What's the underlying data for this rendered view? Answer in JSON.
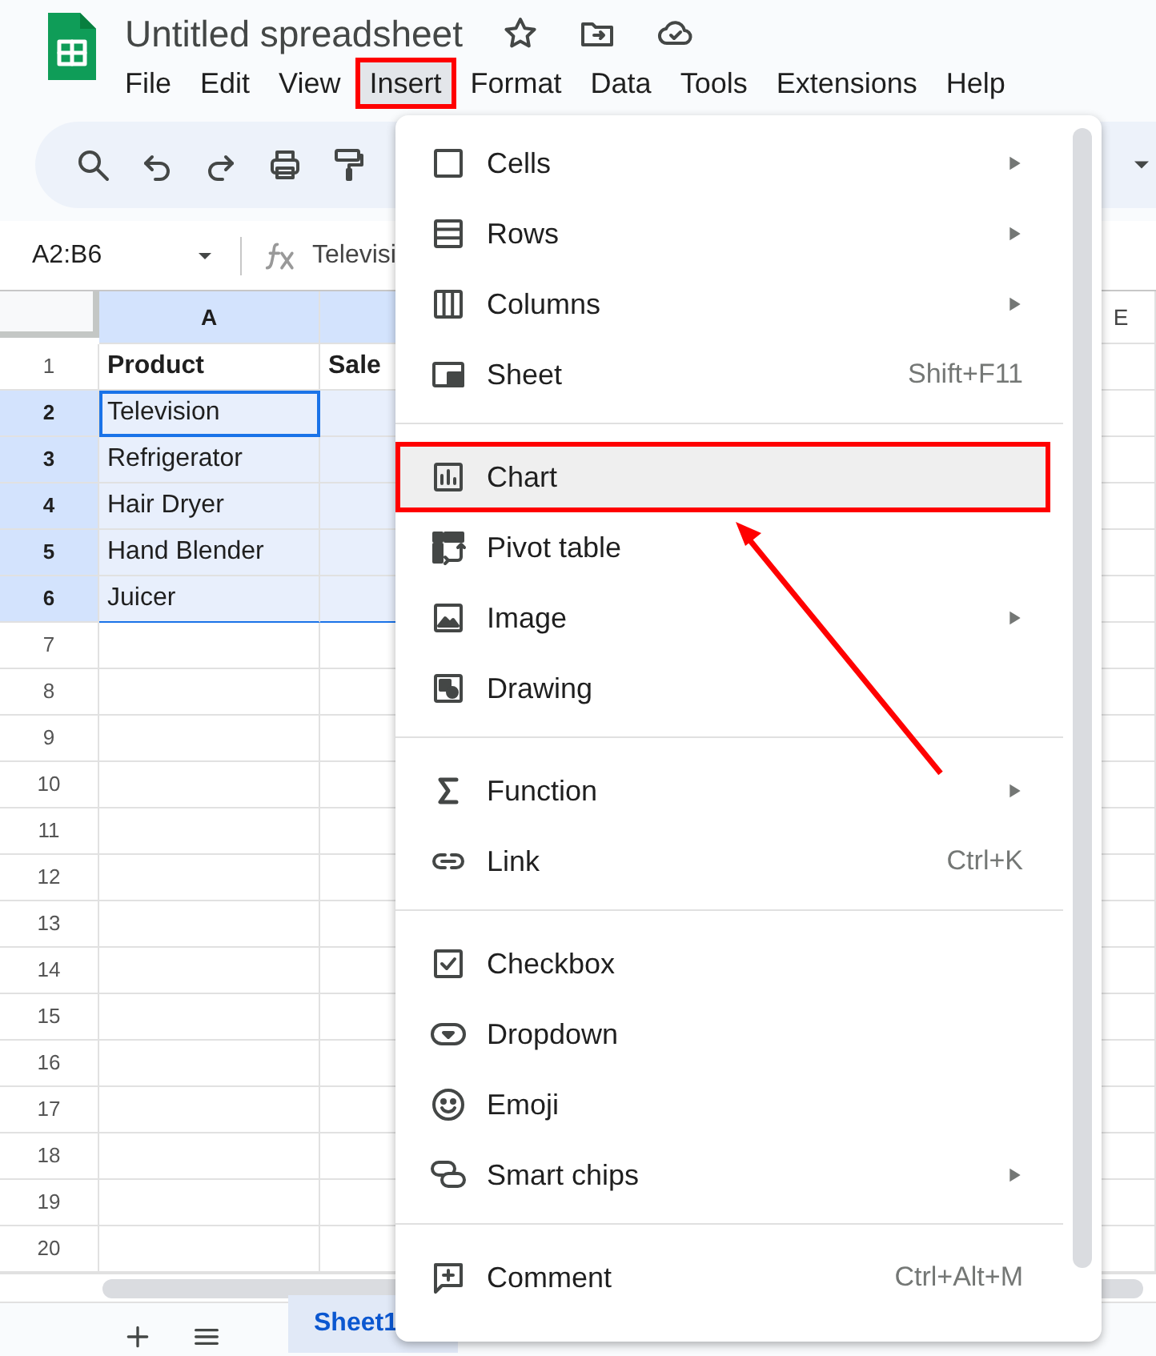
{
  "document": {
    "title": "Untitled spreadsheet"
  },
  "menubar": [
    {
      "label": "File",
      "selected": false,
      "annotated": false
    },
    {
      "label": "Edit",
      "selected": false,
      "annotated": false
    },
    {
      "label": "View",
      "selected": false,
      "annotated": false
    },
    {
      "label": "Insert",
      "selected": true,
      "annotated": true
    },
    {
      "label": "Format",
      "selected": false,
      "annotated": false
    },
    {
      "label": "Data",
      "selected": false,
      "annotated": false
    },
    {
      "label": "Tools",
      "selected": false,
      "annotated": false
    },
    {
      "label": "Extensions",
      "selected": false,
      "annotated": false
    },
    {
      "label": "Help",
      "selected": false,
      "annotated": false
    }
  ],
  "formula_bar": {
    "name_box": "A2:B6",
    "value": "Televisi"
  },
  "columns": [
    {
      "label": "A",
      "selected": true
    },
    {
      "selected": true
    },
    {
      "label": "E",
      "selected": false
    }
  ],
  "rows": [
    {
      "header": "1",
      "kind": "header",
      "selected": false,
      "cells": [
        {
          "text": "Product",
          "active": false
        },
        {
          "text": "Sale",
          "active": false
        }
      ]
    },
    {
      "header": "2",
      "kind": "data",
      "selected": true,
      "cells": [
        {
          "text": "Television",
          "active": true
        }
      ]
    },
    {
      "header": "3",
      "kind": "data",
      "selected": true,
      "cells": [
        {
          "text": "Refrigerator",
          "active": false
        }
      ]
    },
    {
      "header": "4",
      "kind": "data",
      "selected": true,
      "cells": [
        {
          "text": "Hair Dryer",
          "active": false
        }
      ]
    },
    {
      "header": "5",
      "kind": "data",
      "selected": true,
      "cells": [
        {
          "text": "Hand Blender",
          "active": false
        }
      ]
    },
    {
      "header": "6",
      "kind": "data",
      "selected": true,
      "cells": [
        {
          "text": "Juicer",
          "active": false
        }
      ]
    },
    {
      "header": "7",
      "kind": "data",
      "selected": false,
      "cells": []
    },
    {
      "header": "8",
      "kind": "data",
      "selected": false,
      "cells": []
    },
    {
      "header": "9",
      "kind": "data",
      "selected": false,
      "cells": []
    },
    {
      "header": "10",
      "kind": "data",
      "selected": false,
      "cells": []
    },
    {
      "header": "11",
      "kind": "data",
      "selected": false,
      "cells": []
    },
    {
      "header": "12",
      "kind": "data",
      "selected": false,
      "cells": []
    },
    {
      "header": "13",
      "kind": "data",
      "selected": false,
      "cells": []
    },
    {
      "header": "14",
      "kind": "data",
      "selected": false,
      "cells": []
    },
    {
      "header": "15",
      "kind": "data",
      "selected": false,
      "cells": []
    },
    {
      "header": "16",
      "kind": "data",
      "selected": false,
      "cells": []
    },
    {
      "header": "17",
      "kind": "data",
      "selected": false,
      "cells": []
    },
    {
      "header": "18",
      "kind": "data",
      "selected": false,
      "cells": []
    },
    {
      "header": "19",
      "kind": "data",
      "selected": false,
      "cells": []
    },
    {
      "header": "20",
      "kind": "data",
      "selected": false,
      "cells": []
    }
  ],
  "sheet_tabs": [
    {
      "label": "Sheet1",
      "selected": true
    }
  ],
  "insert_menu": {
    "groups": [
      [
        {
          "label": "Cells",
          "submenu": true,
          "highlighted": false,
          "annotated": false
        },
        {
          "label": "Rows",
          "submenu": true,
          "highlighted": false,
          "annotated": false
        },
        {
          "label": "Columns",
          "submenu": true,
          "highlighted": false,
          "annotated": false
        },
        {
          "label": "Sheet",
          "shortcut": "Shift+F11",
          "submenu": false,
          "highlighted": false,
          "annotated": false
        }
      ],
      [
        {
          "label": "Chart",
          "submenu": false,
          "highlighted": true,
          "annotated": true
        },
        {
          "label": "Pivot table",
          "submenu": false,
          "highlighted": false,
          "annotated": false
        },
        {
          "label": "Image",
          "submenu": true,
          "highlighted": false,
          "annotated": false
        },
        {
          "label": "Drawing",
          "submenu": false,
          "highlighted": false,
          "annotated": false
        }
      ],
      [
        {
          "label": "Function",
          "submenu": true,
          "highlighted": false,
          "annotated": false
        },
        {
          "label": "Link",
          "shortcut": "Ctrl+K",
          "submenu": false,
          "highlighted": false,
          "annotated": false
        }
      ],
      [
        {
          "label": "Checkbox",
          "submenu": false,
          "highlighted": false,
          "annotated": false
        },
        {
          "label": "Dropdown",
          "submenu": false,
          "highlighted": false,
          "annotated": false
        },
        {
          "label": "Emoji",
          "submenu": false,
          "highlighted": false,
          "annotated": false
        },
        {
          "label": "Smart chips",
          "submenu": true,
          "highlighted": false,
          "annotated": false
        }
      ],
      [
        {
          "label": "Comment",
          "shortcut": "Ctrl+Alt+M",
          "submenu": false,
          "highlighted": false,
          "annotated": false
        }
      ]
    ]
  }
}
